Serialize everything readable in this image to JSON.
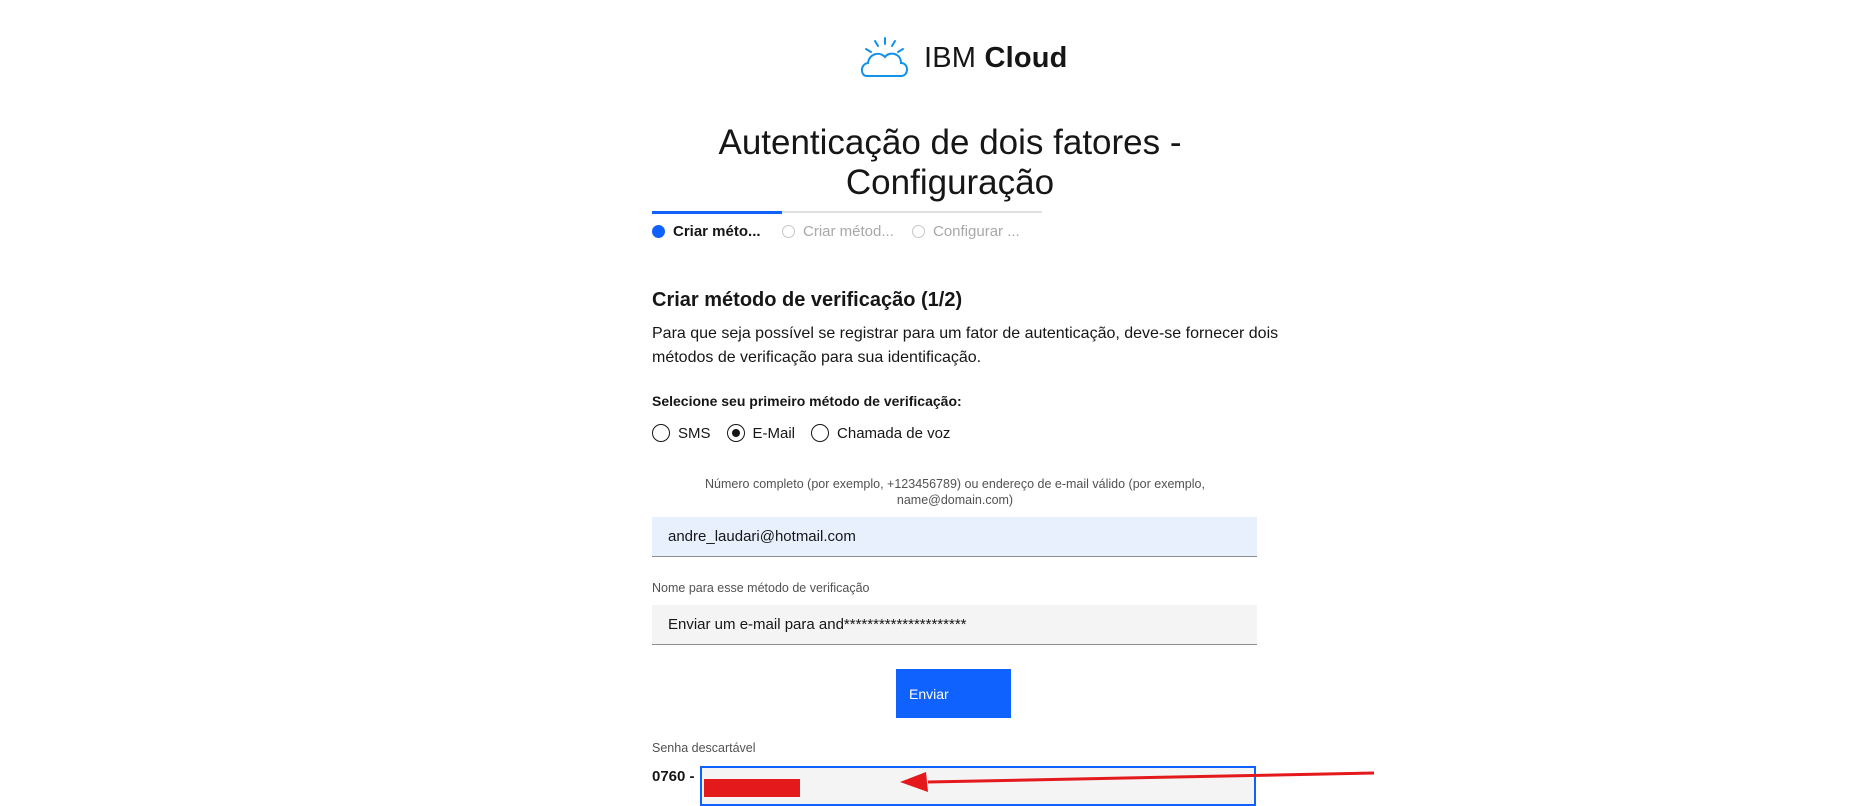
{
  "brand": {
    "prefix": "IBM",
    "name": "Cloud"
  },
  "page": {
    "title": "Autenticação de dois fatores - Configuração"
  },
  "progress": {
    "completed_fraction": 0.33,
    "steps": [
      {
        "label": "Criar méto...",
        "state": "current"
      },
      {
        "label": "Criar métod...",
        "state": "incomplete"
      },
      {
        "label": "Configurar ...",
        "state": "incomplete"
      }
    ]
  },
  "section": {
    "heading": "Criar método de verificação (1/2)",
    "description": "Para que seja possível se registrar para um fator de autenticação, deve-se fornecer dois métodos de verificação para sua identificação.",
    "select_label": "Selecione seu primeiro método de verificação:",
    "methods": [
      {
        "label": "SMS",
        "checked": false
      },
      {
        "label": "E-Mail",
        "checked": true
      },
      {
        "label": "Chamada de voz",
        "checked": false
      }
    ]
  },
  "form": {
    "contact_helper": "Número completo (por exemplo, +123456789) ou endereço de e-mail válido (por exemplo, name@domain.com)",
    "contact_value": "andre_laudari@hotmail.com",
    "name_label": "Nome para esse método de verificação",
    "name_value": "Enviar um e-mail para and*********************",
    "send_label": "Enviar",
    "otp_label": "Senha descartável",
    "otp_prefix": "0760  -"
  },
  "colors": {
    "accent": "#0f62fe",
    "annotation": "#e3191b",
    "field_bg": "#f4f4f4",
    "autofill_bg": "#e8f0fe"
  }
}
